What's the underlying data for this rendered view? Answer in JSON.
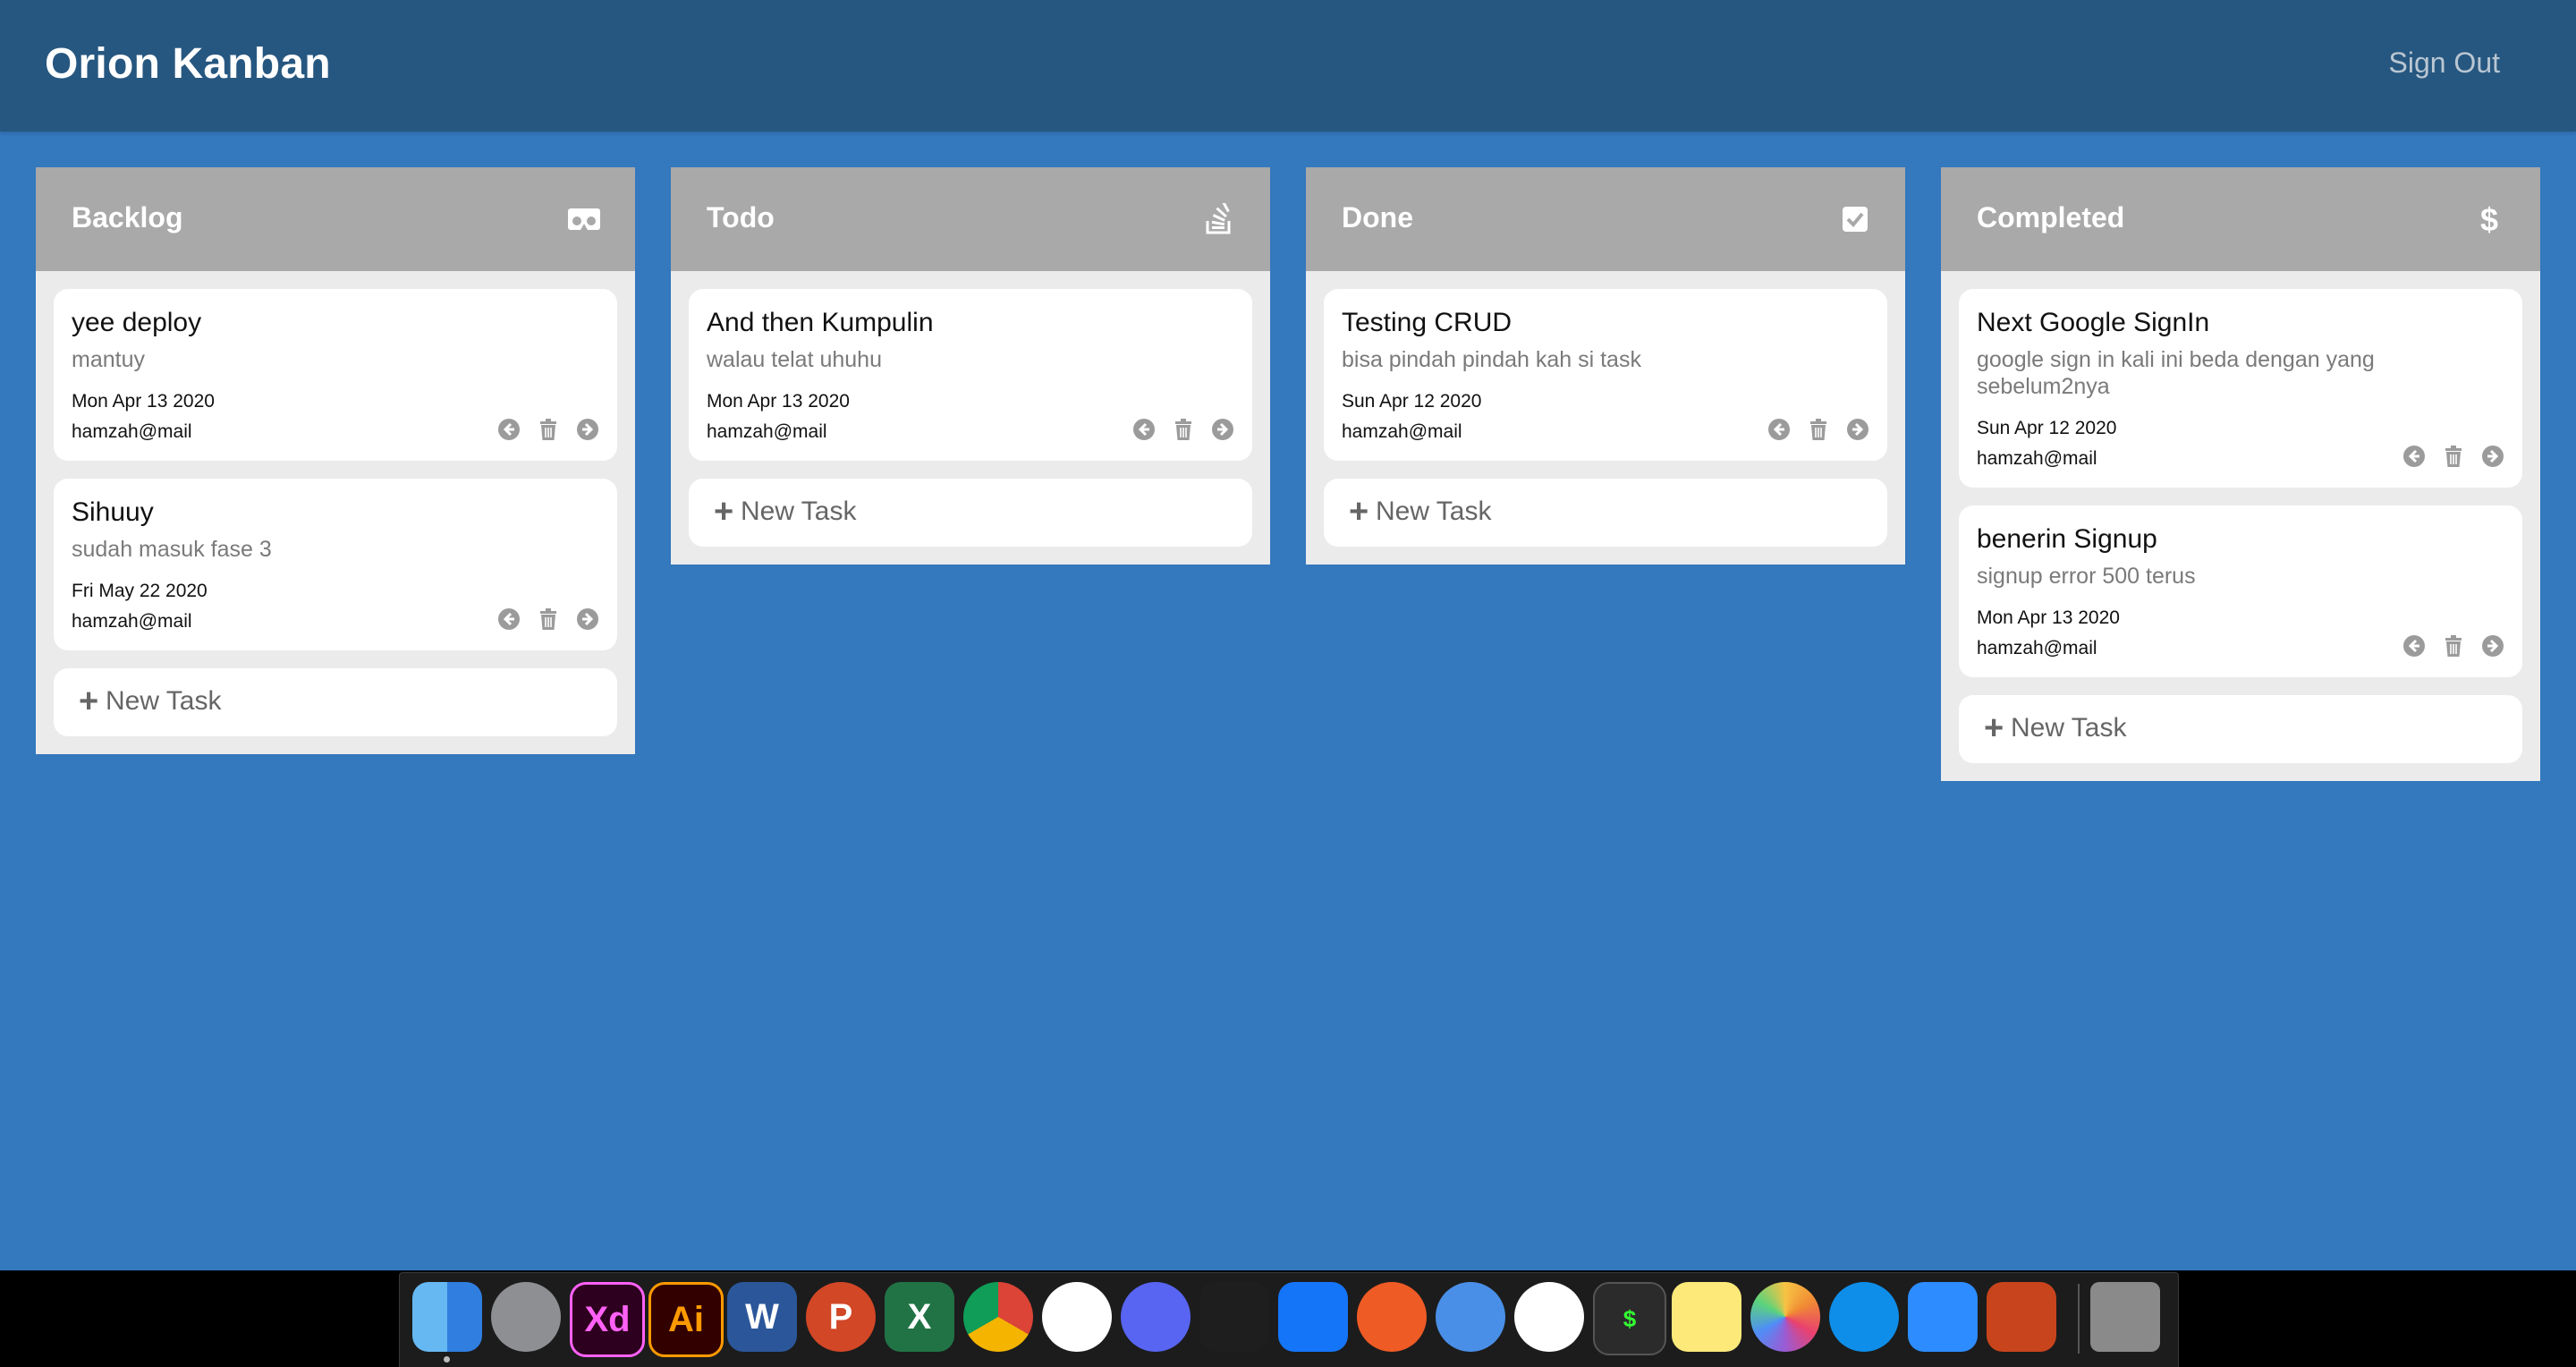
{
  "app": {
    "title": "Orion Kanban",
    "signout_label": "Sign Out"
  },
  "new_task_label": "New Task",
  "columns": [
    {
      "title": "Backlog",
      "icon": "cardboard-icon",
      "tasks": [
        {
          "title": "yee deploy",
          "description": "mantuy",
          "date": "Mon Apr 13 2020",
          "email": "hamzah@mail"
        },
        {
          "title": "Sihuuy",
          "description": "sudah masuk fase 3",
          "date": "Fri May 22 2020",
          "email": "hamzah@mail"
        }
      ]
    },
    {
      "title": "Todo",
      "icon": "stack-overflow-icon",
      "tasks": [
        {
          "title": "And then Kumpulin",
          "description": "walau telat uhuhu",
          "date": "Mon Apr 13 2020",
          "email": "hamzah@mail"
        }
      ]
    },
    {
      "title": "Done",
      "icon": "check-square-icon",
      "tasks": [
        {
          "title": "Testing CRUD",
          "description": "bisa pindah pindah kah si task",
          "date": "Sun Apr 12 2020",
          "email": "hamzah@mail"
        }
      ]
    },
    {
      "title": "Completed",
      "icon": "dollar-icon",
      "tasks": [
        {
          "title": "Next Google SignIn",
          "description": "google sign in kali ini beda dengan yang sebelum2nya",
          "date": "Sun Apr 12 2020",
          "email": "hamzah@mail"
        },
        {
          "title": "benerin Signup",
          "description": "signup error 500 terus",
          "date": "Mon Apr 13 2020",
          "email": "hamzah@mail"
        }
      ]
    }
  ],
  "dock": {
    "apps": [
      "finder-icon",
      "launchpad-icon",
      "adobe-xd-icon",
      "adobe-illustrator-icon",
      "word-icon",
      "powerpoint-icon",
      "excel-icon",
      "chrome-icon",
      "slack-icon",
      "discord-icon",
      "vscode-icon",
      "xcode-icon",
      "postman-icon",
      "tableplus-icon",
      "mongodb-compass-icon",
      "terminal-icon",
      "notes-icon",
      "photos-icon",
      "teamviewer-icon",
      "zoom-icon",
      "hacktiv8-icon",
      "trash-icon"
    ],
    "labels": {
      "xd": "Xd",
      "ai": "Ai",
      "word": "W",
      "powerpoint": "P",
      "excel": "X",
      "terminal": "$"
    },
    "colors": {
      "background": "#1c1c1c"
    }
  },
  "colors": {
    "page_bg": "#3478be",
    "navbar_bg": "#265780",
    "column_header": "#a9a9a9",
    "column_body": "#ebebeb"
  }
}
